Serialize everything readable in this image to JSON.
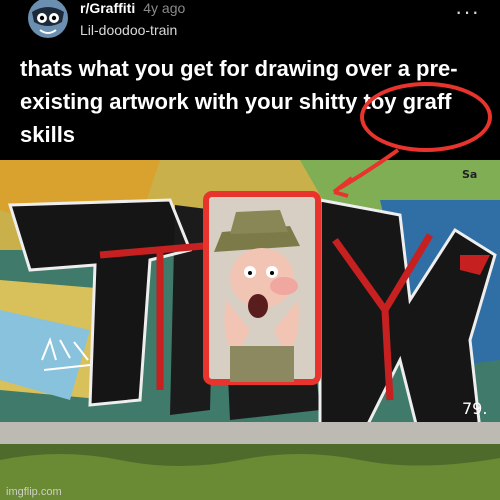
{
  "post": {
    "subreddit": "r/Graffiti",
    "age": "4y ago",
    "author": "Lil-doodoo-train",
    "more_icon": "more-icon",
    "title": "thats what you get for drawing over a pre-existing artwork with your shitty toy graff skills"
  },
  "image": {
    "tags": [
      "Sa",
      "79."
    ],
    "watermark": "imgflip.com"
  },
  "colors": {
    "background": "#000000",
    "annotation_red": "#e8342c"
  }
}
